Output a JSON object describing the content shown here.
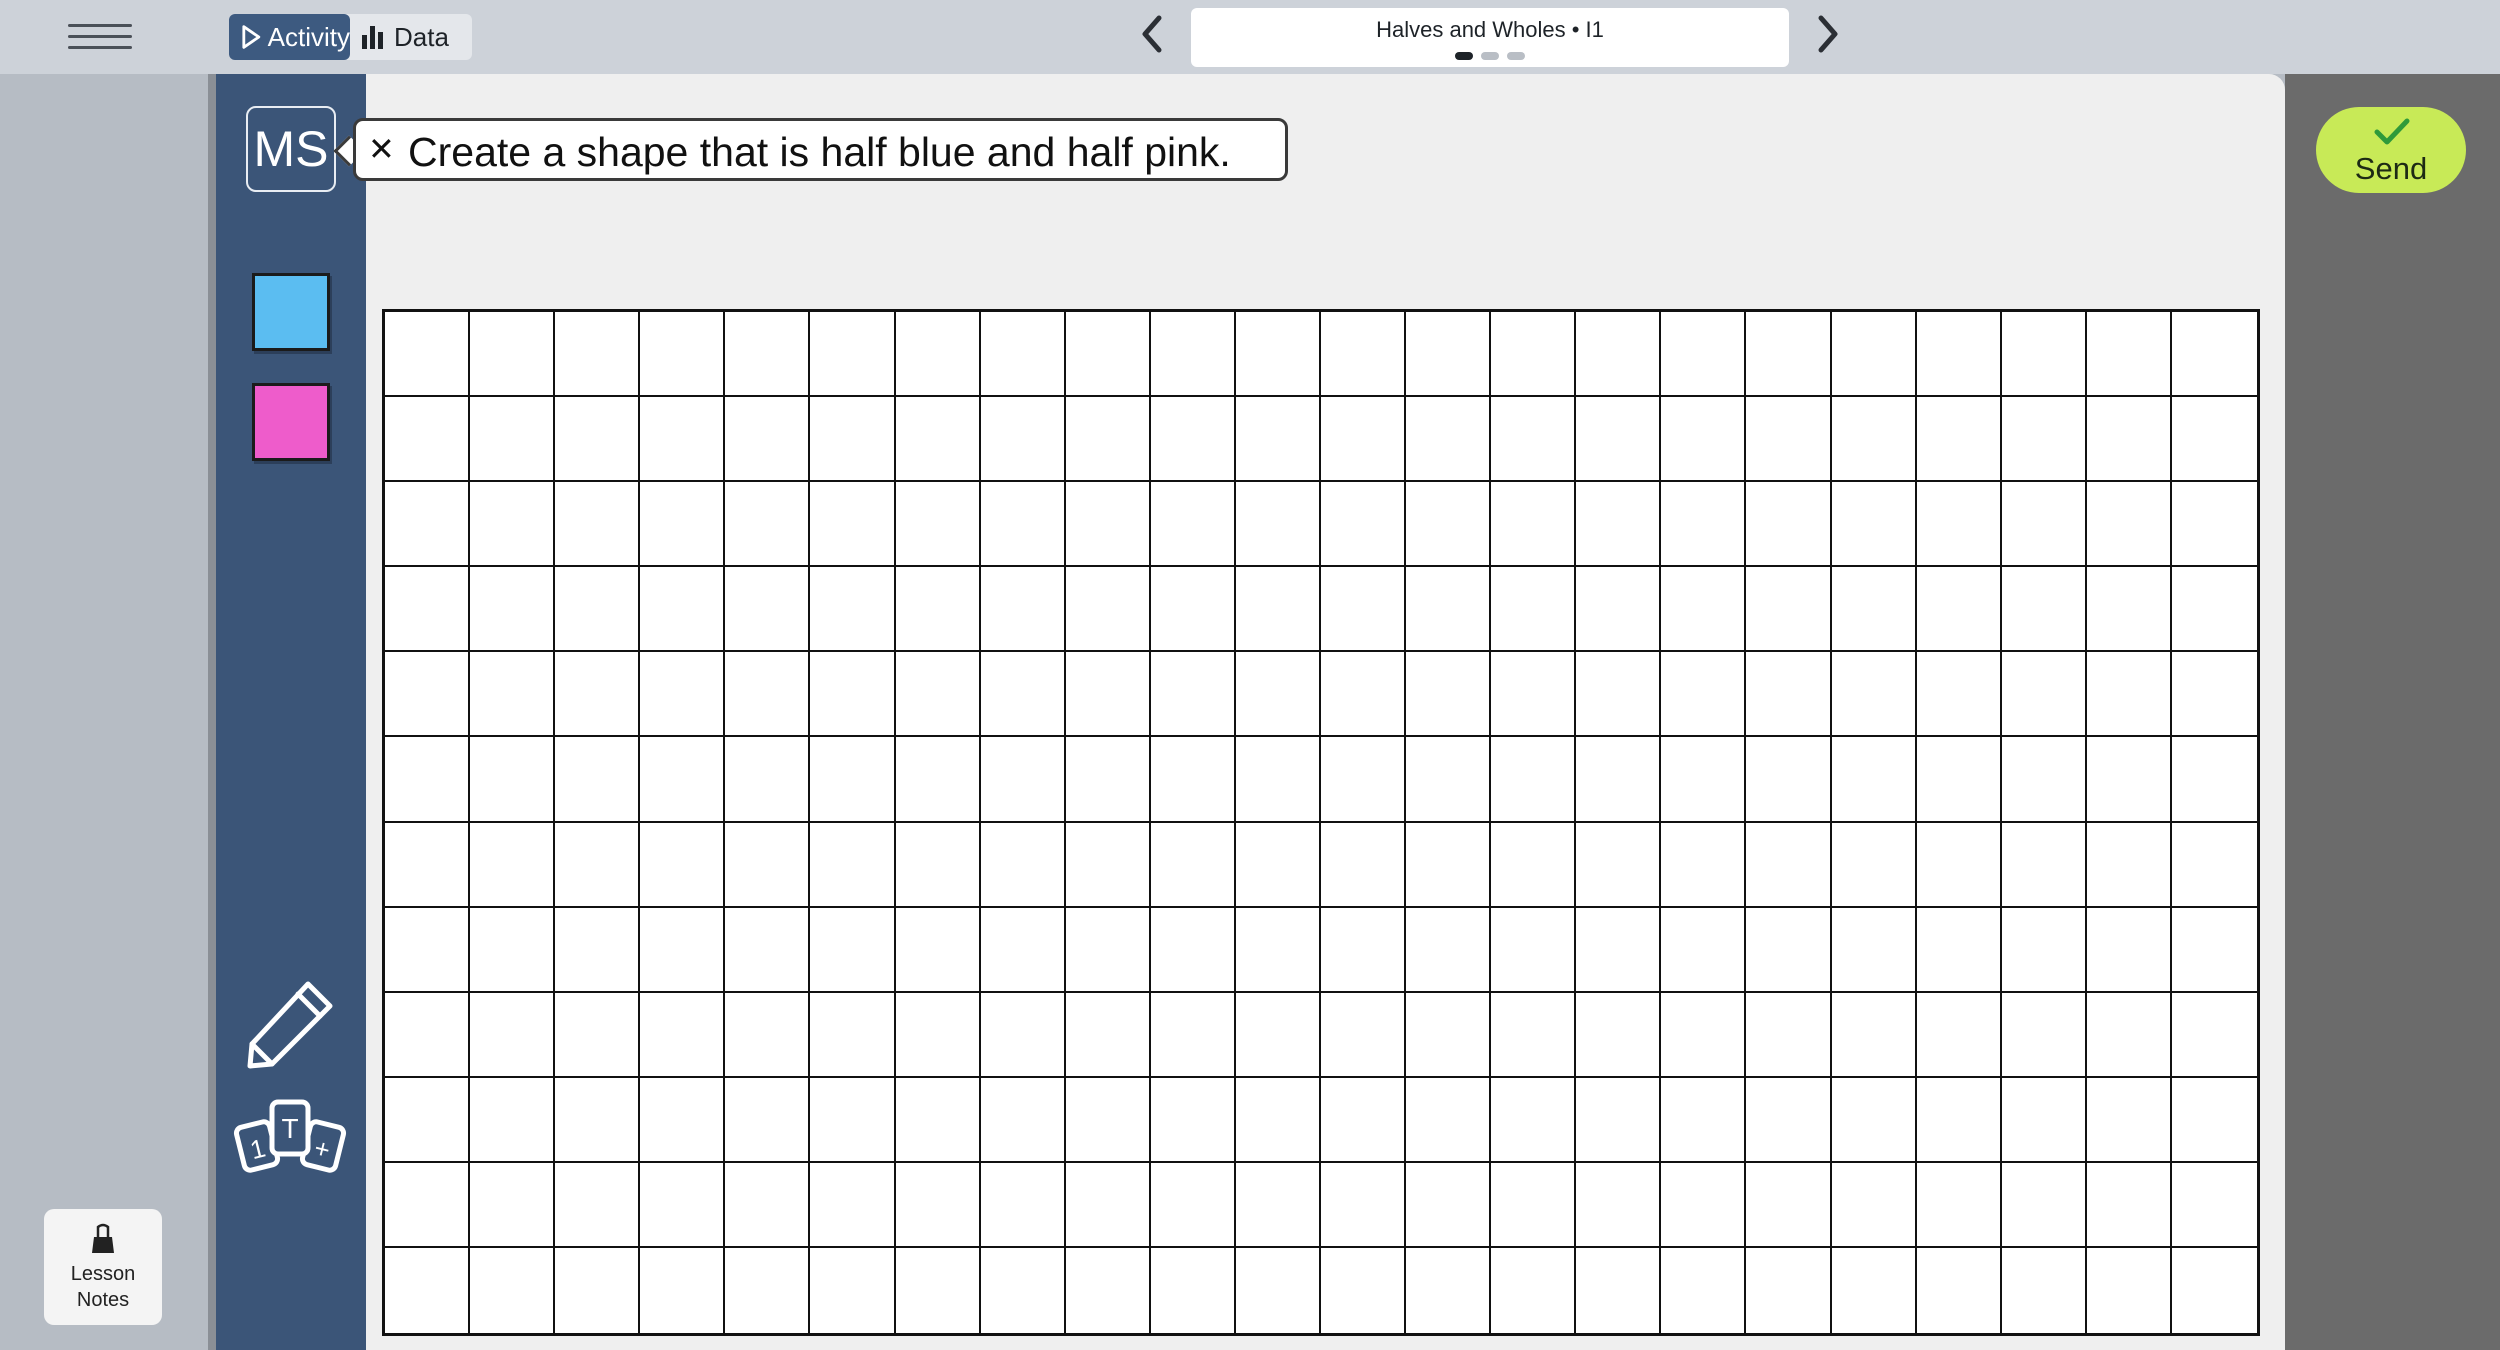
{
  "topbar": {
    "tabs": [
      {
        "label": "Activity",
        "icon": "play-icon",
        "active": true
      },
      {
        "label": "Data",
        "icon": "bar-chart-icon",
        "active": false
      }
    ],
    "title": "Halves and Wholes • I1",
    "page_count": 3,
    "current_page": 1
  },
  "sidebar": {
    "avatar_initials": "MS",
    "colors": {
      "blue": "#5bbdf1",
      "pink": "#ee5ccb",
      "panel": "#3b5578"
    }
  },
  "prompt": {
    "close_glyph": "✕",
    "text": "Create a shape that is half blue and half pink."
  },
  "grid": {
    "rows": 12,
    "cols": 22
  },
  "send": {
    "label": "Send",
    "color": "#c8ea57"
  },
  "lesson_notes": {
    "label": "Lesson\nNotes"
  }
}
